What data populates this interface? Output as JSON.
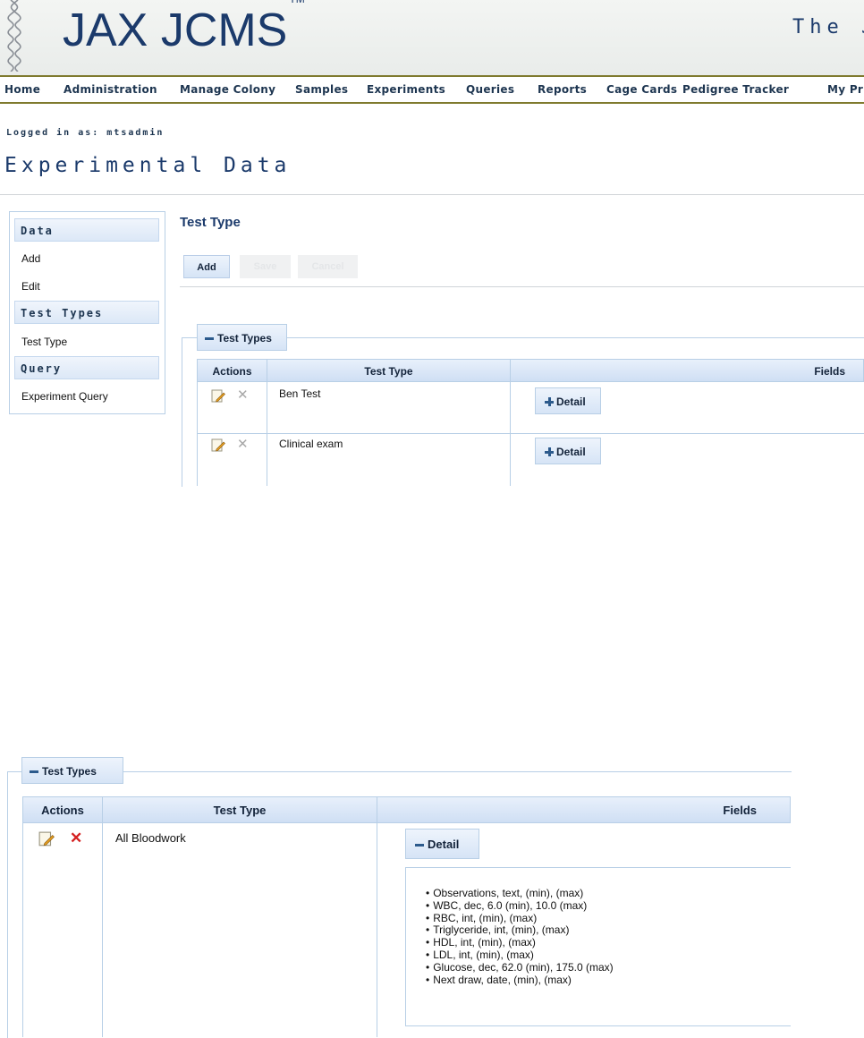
{
  "header": {
    "logo_text": "JAX JCMS",
    "trademark": "TM",
    "tagline": "The J"
  },
  "nav": {
    "items": [
      "Home",
      "Administration",
      "Manage Colony",
      "Samples",
      "Experiments",
      "Queries",
      "Reports",
      "Cage Cards",
      "Pedigree Tracker",
      "My Pr"
    ]
  },
  "user": {
    "logged_in_text": "Logged in as: mtsadmin"
  },
  "page": {
    "title": "Experimental Data"
  },
  "sidebar": {
    "sections": [
      {
        "heading": "Data",
        "items": [
          "Add",
          "Edit"
        ]
      },
      {
        "heading": "Test Types",
        "items": [
          "Test Type"
        ]
      },
      {
        "heading": "Query",
        "items": [
          "Experiment Query"
        ]
      }
    ]
  },
  "section": {
    "title": "Test Type",
    "buttons": {
      "add": "Add",
      "save": "Save",
      "cancel": "Cancel"
    }
  },
  "panel1": {
    "legend": "Test Types",
    "columns": {
      "actions": "Actions",
      "test_type": "Test Type",
      "fields": "Fields"
    },
    "rows": [
      {
        "test_type": "Ben Test",
        "detail_label": "Detail"
      },
      {
        "test_type": "Clinical exam",
        "detail_label": "Detail"
      }
    ]
  },
  "panel2": {
    "legend": "Test Types",
    "columns": {
      "actions": "Actions",
      "test_type": "Test Type",
      "fields": "Fields"
    },
    "row": {
      "test_type": "All Bloodwork",
      "detail_label": "Detail",
      "fields": [
        "Observations, text, (min), (max)",
        "WBC, dec, 6.0 (min), 10.0 (max)",
        "RBC, int, (min), (max)",
        "Triglyceride, int, (min), (max)",
        "HDL, int, (min), (max)",
        "LDL, int, (min), (max)",
        "Glucose, dec, 62.0 (min), 175.0 (max)",
        "Next draw, date, (min), (max)"
      ]
    }
  },
  "colors": {
    "brand_blue": "#1b3a6b",
    "header_rule": "#7f7a2e",
    "panel_border": "#b8cfe6",
    "delete_red": "#d42020",
    "delete_gray": "#a8a8a8"
  }
}
